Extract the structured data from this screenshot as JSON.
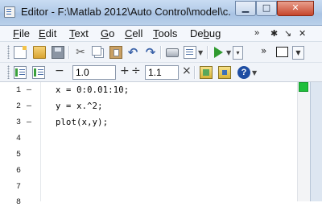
{
  "window": {
    "title": "Editor - F:\\Matlab 2012\\Auto Control\\model\\c...",
    "min_label": "▁",
    "max_label": "□",
    "close_label": "✕"
  },
  "menu": {
    "items": [
      {
        "underline": "F",
        "rest": "ile"
      },
      {
        "underline": "E",
        "rest": "dit"
      },
      {
        "underline": "T",
        "rest": "ext"
      },
      {
        "underline": "G",
        "rest": "o"
      },
      {
        "underline": "C",
        "rest": "ell"
      },
      {
        "underline": "T",
        "rest": "ools"
      },
      {
        "underline": "",
        "rest": "Debug",
        "prefix": "De",
        "mid": "b",
        "suffix": "ug"
      }
    ],
    "overflow": "»",
    "pin": "✱",
    "restore": "↘",
    "close": "✕"
  },
  "cell_toolbar": {
    "minus": "−",
    "step1": "1.0",
    "plus": "+",
    "divide": "÷",
    "step2": "1.1",
    "times": "×"
  },
  "editor": {
    "lines": [
      {
        "n": "1",
        "dash": "—",
        "code": "x = 0:0.01:10;"
      },
      {
        "n": "2",
        "dash": "—",
        "code": "y = x.^2;"
      },
      {
        "n": "3",
        "dash": "—",
        "code": "plot(x,y);"
      },
      {
        "n": "4",
        "dash": "",
        "code": ""
      },
      {
        "n": "5",
        "dash": "",
        "code": ""
      },
      {
        "n": "6",
        "dash": "",
        "code": ""
      },
      {
        "n": "7",
        "dash": "",
        "code": ""
      },
      {
        "n": "8",
        "dash": "",
        "code": ""
      }
    ],
    "status_color": "#1fbf3c"
  }
}
